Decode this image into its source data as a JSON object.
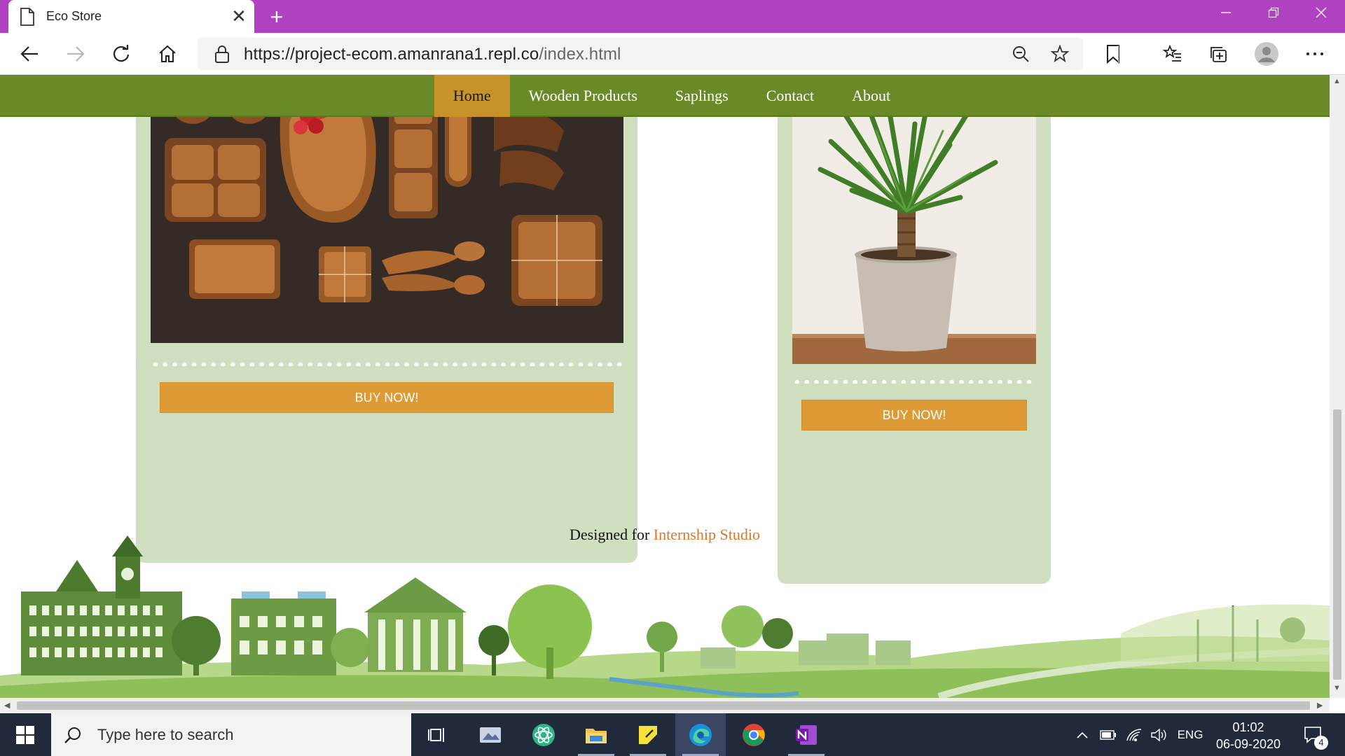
{
  "browser": {
    "tab_title": "Eco Store",
    "tab_close": "✕",
    "new_tab": "+",
    "url_host": "https://project-ecom.amanrana1.repl.co",
    "url_path": "/index.html"
  },
  "site": {
    "nav": [
      {
        "label": "Home",
        "active": true
      },
      {
        "label": "Wooden Products"
      },
      {
        "label": "Saplings"
      },
      {
        "label": "Contact"
      },
      {
        "label": "About"
      }
    ],
    "products": [
      {
        "button": "BUY NOW!"
      },
      {
        "button": "BUY NOW!"
      }
    ],
    "footer": {
      "prefix": "Designed for ",
      "link": "Internship Studio"
    }
  },
  "taskbar": {
    "search_placeholder": "Type here to search",
    "language": "ENG",
    "time": "01:02",
    "date": "06-09-2020",
    "notifications": "4"
  },
  "colors": {
    "title_bar": "#b042c2",
    "site_nav": "#6a8a28",
    "nav_active": "#c8922a",
    "card": "#d0dfbf",
    "buy_button": "#de9b35",
    "footer_link": "#d9782a"
  }
}
